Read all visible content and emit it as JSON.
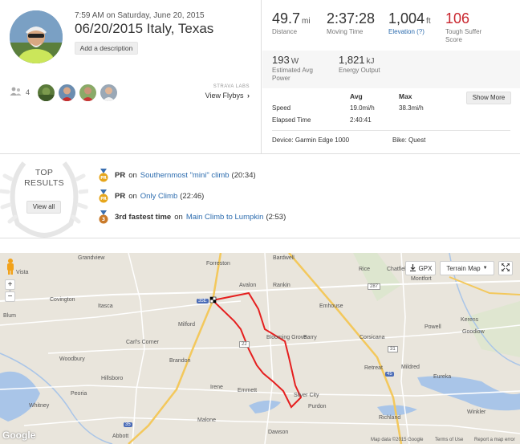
{
  "header": {
    "datetime": "7:59 AM on Saturday, June 20, 2015",
    "title": "06/20/2015 Italy, Texas",
    "add_description": "Add a description",
    "kudos_count": "4",
    "labs_caption": "STRAVA LABS",
    "flyby_label": "View Flybys"
  },
  "stats": {
    "distance_value": "49.7",
    "distance_unit": "mi",
    "distance_label": "Distance",
    "moving_time_value": "2:37:28",
    "moving_time_label": "Moving Time",
    "elevation_value": "1,004",
    "elevation_unit": "ft",
    "elevation_label": "Elevation (?)",
    "suffer_value": "106",
    "suffer_label_1": "Tough Suffer",
    "suffer_label_2": "Score",
    "power_value": "193",
    "power_unit": "W",
    "power_label_1": "Estimated Avg",
    "power_label_2": "Power",
    "energy_value": "1,821",
    "energy_unit": "kJ",
    "energy_label": "Energy Output"
  },
  "table": {
    "avg_header": "Avg",
    "max_header": "Max",
    "show_more": "Show More",
    "speed_label": "Speed",
    "speed_avg": "19.0mi/h",
    "speed_max": "38.3mi/h",
    "elapsed_label": "Elapsed Time",
    "elapsed_value": "2:40:41",
    "device": "Device: Garmin Edge 1000",
    "bike": "Bike: Quest"
  },
  "achievements": {
    "top_results_line1": "TOP",
    "top_results_line2": "RESULTS",
    "view_all": "View all",
    "items": [
      {
        "prefix": "PR",
        "mid": "on",
        "segment": "Southernmost \"mini\" climb",
        "time": "(20:34)"
      },
      {
        "prefix": "PR",
        "mid": "on",
        "segment": "Only Climb",
        "time": "(22:46)"
      },
      {
        "prefix": "3rd fastest time",
        "mid": "on",
        "segment": "Main Climb to Lumpkin",
        "time": "(2:53)"
      }
    ]
  },
  "map": {
    "gpx_label": "GPX",
    "map_type": "Terrain Map",
    "towns": [
      "Grandview",
      "Forreston",
      "Bardwell",
      "Rice",
      "Chatfield",
      "Montfort",
      "Vista",
      "Avalon",
      "Rankin",
      "Covington",
      "Itasca",
      "Emhouse",
      "Blum",
      "Milford",
      "Powell",
      "Kerens",
      "Goodlow",
      "Carl's Corner",
      "Blooming Grove",
      "Barry",
      "Corsicana",
      "Brandon",
      "Woodbury",
      "Hillsboro",
      "Retreat",
      "Mildred",
      "Eureka",
      "Irene",
      "Emmett",
      "Silver City",
      "Peoria",
      "Whitney",
      "Purdon",
      "Richland",
      "Winkler",
      "Malone",
      "Abbott",
      "Dawson"
    ],
    "highway_labels": [
      "35E",
      "22",
      "287",
      "31",
      "45",
      "35"
    ],
    "footer_data": "Map data ©2015 Google",
    "footer_terms": "Terms of Use",
    "footer_report": "Report a map error",
    "google": "Google"
  },
  "colors": {
    "accent_red": "#c9262e",
    "link_blue": "#2b6bae",
    "route_red": "#e51f1f",
    "medal_gold": "#e6a61b",
    "medal_bronze": "#c97a2a"
  }
}
